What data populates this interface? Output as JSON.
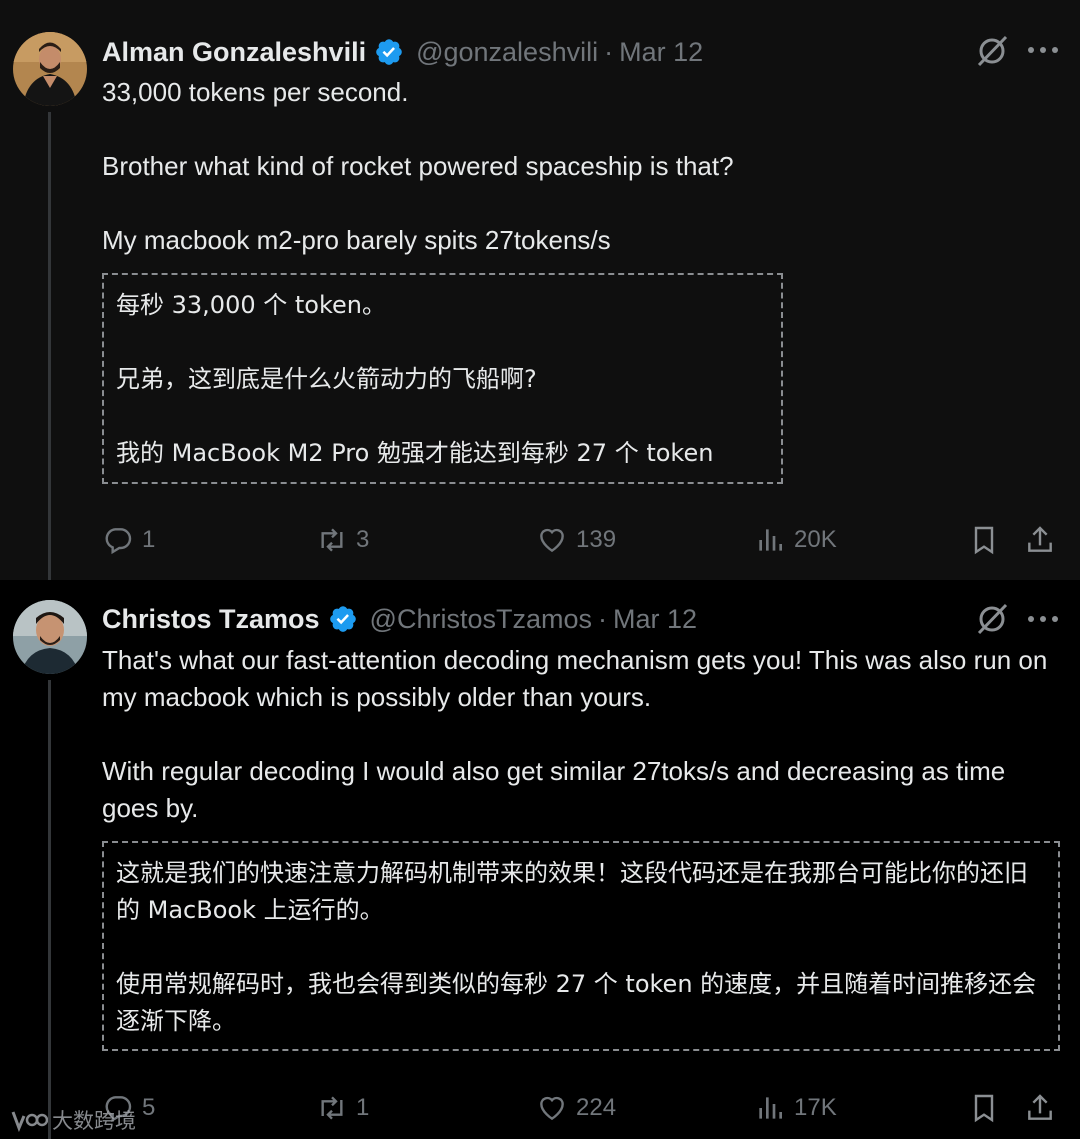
{
  "tweets": [
    {
      "author": "Alman Gonzaleshvili",
      "handle": "@gonzaleshvili",
      "separator": "·",
      "date": "Mar 12",
      "text": [
        "33,000 tokens per second.",
        "Brother what kind of rocket powered spaceship is that?",
        "My macbook m2-pro barely spits 27tokens/s"
      ],
      "translation": [
        "每秒 33,000 个 token。",
        "兄弟，这到底是什么火箭动力的飞船啊?",
        "我的 MacBook M2 Pro 勉强才能达到每秒 27 个 token"
      ],
      "stats": {
        "replies": "1",
        "reposts": "3",
        "likes": "139",
        "views": "20K"
      }
    },
    {
      "author": "Christos Tzamos",
      "handle": "@ChristosTzamos",
      "separator": "·",
      "date": "Mar 12",
      "text": [
        "That's what our fast-attention decoding mechanism gets you! This was also run on my macbook which is possibly older than yours.",
        "With regular decoding I would also get similar 27toks/s and decreasing as time goes by."
      ],
      "translation": [
        "这就是我们的快速注意力解码机制带来的效果！这段代码还是在我那台可能比你的还旧的 MacBook 上运行的。",
        "使用常规解码时，我也会得到类似的每秒 27 个 token 的速度，并且随着时间推移还会逐渐下降。"
      ],
      "stats": {
        "replies": "5",
        "reposts": "1",
        "likes": "224",
        "views": "17K"
      }
    }
  ],
  "watermark": "大数跨境",
  "icons": [
    "verified-badge-icon",
    "grok-icon",
    "more-icon",
    "reply-icon",
    "repost-icon",
    "like-icon",
    "views-icon",
    "bookmark-icon",
    "share-icon"
  ],
  "colors": {
    "verified": "#1d9bf0",
    "muted": "#71767b",
    "text": "#e7e9ea"
  }
}
